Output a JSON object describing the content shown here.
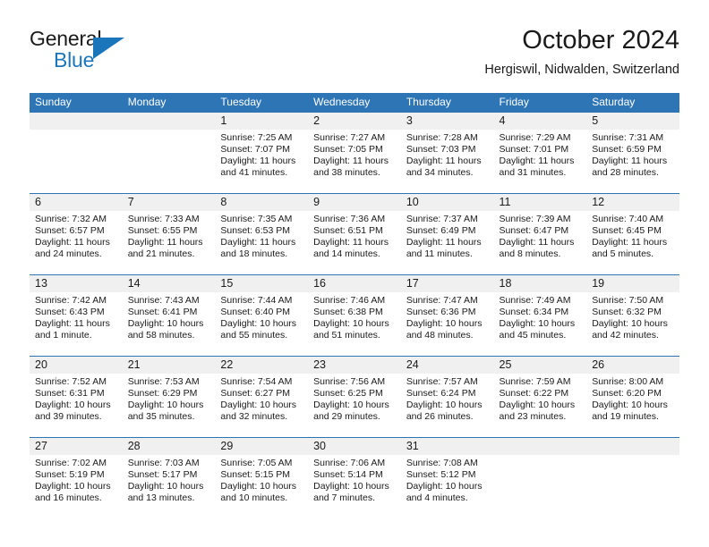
{
  "logo": {
    "word_one": "General",
    "word_two": "Blue",
    "flag_icon": "triangle-flag-icon",
    "accent_color": "#1b75bb"
  },
  "header": {
    "month_title": "October 2024",
    "location": "Hergiswil, Nidwalden, Switzerland"
  },
  "theme": {
    "header_bar_color": "#2e75b6",
    "daynum_band_color": "#f0f0f0",
    "text_color": "#1a1a1a"
  },
  "weekday_headers": [
    "Sunday",
    "Monday",
    "Tuesday",
    "Wednesday",
    "Thursday",
    "Friday",
    "Saturday"
  ],
  "weeks": [
    [
      {
        "day": "",
        "sunrise": "",
        "sunset": "",
        "daylight_line1": "",
        "daylight_line2": ""
      },
      {
        "day": "",
        "sunrise": "",
        "sunset": "",
        "daylight_line1": "",
        "daylight_line2": ""
      },
      {
        "day": "1",
        "sunrise": "Sunrise: 7:25 AM",
        "sunset": "Sunset: 7:07 PM",
        "daylight_line1": "Daylight: 11 hours",
        "daylight_line2": "and 41 minutes."
      },
      {
        "day": "2",
        "sunrise": "Sunrise: 7:27 AM",
        "sunset": "Sunset: 7:05 PM",
        "daylight_line1": "Daylight: 11 hours",
        "daylight_line2": "and 38 minutes."
      },
      {
        "day": "3",
        "sunrise": "Sunrise: 7:28 AM",
        "sunset": "Sunset: 7:03 PM",
        "daylight_line1": "Daylight: 11 hours",
        "daylight_line2": "and 34 minutes."
      },
      {
        "day": "4",
        "sunrise": "Sunrise: 7:29 AM",
        "sunset": "Sunset: 7:01 PM",
        "daylight_line1": "Daylight: 11 hours",
        "daylight_line2": "and 31 minutes."
      },
      {
        "day": "5",
        "sunrise": "Sunrise: 7:31 AM",
        "sunset": "Sunset: 6:59 PM",
        "daylight_line1": "Daylight: 11 hours",
        "daylight_line2": "and 28 minutes."
      }
    ],
    [
      {
        "day": "6",
        "sunrise": "Sunrise: 7:32 AM",
        "sunset": "Sunset: 6:57 PM",
        "daylight_line1": "Daylight: 11 hours",
        "daylight_line2": "and 24 minutes."
      },
      {
        "day": "7",
        "sunrise": "Sunrise: 7:33 AM",
        "sunset": "Sunset: 6:55 PM",
        "daylight_line1": "Daylight: 11 hours",
        "daylight_line2": "and 21 minutes."
      },
      {
        "day": "8",
        "sunrise": "Sunrise: 7:35 AM",
        "sunset": "Sunset: 6:53 PM",
        "daylight_line1": "Daylight: 11 hours",
        "daylight_line2": "and 18 minutes."
      },
      {
        "day": "9",
        "sunrise": "Sunrise: 7:36 AM",
        "sunset": "Sunset: 6:51 PM",
        "daylight_line1": "Daylight: 11 hours",
        "daylight_line2": "and 14 minutes."
      },
      {
        "day": "10",
        "sunrise": "Sunrise: 7:37 AM",
        "sunset": "Sunset: 6:49 PM",
        "daylight_line1": "Daylight: 11 hours",
        "daylight_line2": "and 11 minutes."
      },
      {
        "day": "11",
        "sunrise": "Sunrise: 7:39 AM",
        "sunset": "Sunset: 6:47 PM",
        "daylight_line1": "Daylight: 11 hours",
        "daylight_line2": "and 8 minutes."
      },
      {
        "day": "12",
        "sunrise": "Sunrise: 7:40 AM",
        "sunset": "Sunset: 6:45 PM",
        "daylight_line1": "Daylight: 11 hours",
        "daylight_line2": "and 5 minutes."
      }
    ],
    [
      {
        "day": "13",
        "sunrise": "Sunrise: 7:42 AM",
        "sunset": "Sunset: 6:43 PM",
        "daylight_line1": "Daylight: 11 hours",
        "daylight_line2": "and 1 minute."
      },
      {
        "day": "14",
        "sunrise": "Sunrise: 7:43 AM",
        "sunset": "Sunset: 6:41 PM",
        "daylight_line1": "Daylight: 10 hours",
        "daylight_line2": "and 58 minutes."
      },
      {
        "day": "15",
        "sunrise": "Sunrise: 7:44 AM",
        "sunset": "Sunset: 6:40 PM",
        "daylight_line1": "Daylight: 10 hours",
        "daylight_line2": "and 55 minutes."
      },
      {
        "day": "16",
        "sunrise": "Sunrise: 7:46 AM",
        "sunset": "Sunset: 6:38 PM",
        "daylight_line1": "Daylight: 10 hours",
        "daylight_line2": "and 51 minutes."
      },
      {
        "day": "17",
        "sunrise": "Sunrise: 7:47 AM",
        "sunset": "Sunset: 6:36 PM",
        "daylight_line1": "Daylight: 10 hours",
        "daylight_line2": "and 48 minutes."
      },
      {
        "day": "18",
        "sunrise": "Sunrise: 7:49 AM",
        "sunset": "Sunset: 6:34 PM",
        "daylight_line1": "Daylight: 10 hours",
        "daylight_line2": "and 45 minutes."
      },
      {
        "day": "19",
        "sunrise": "Sunrise: 7:50 AM",
        "sunset": "Sunset: 6:32 PM",
        "daylight_line1": "Daylight: 10 hours",
        "daylight_line2": "and 42 minutes."
      }
    ],
    [
      {
        "day": "20",
        "sunrise": "Sunrise: 7:52 AM",
        "sunset": "Sunset: 6:31 PM",
        "daylight_line1": "Daylight: 10 hours",
        "daylight_line2": "and 39 minutes."
      },
      {
        "day": "21",
        "sunrise": "Sunrise: 7:53 AM",
        "sunset": "Sunset: 6:29 PM",
        "daylight_line1": "Daylight: 10 hours",
        "daylight_line2": "and 35 minutes."
      },
      {
        "day": "22",
        "sunrise": "Sunrise: 7:54 AM",
        "sunset": "Sunset: 6:27 PM",
        "daylight_line1": "Daylight: 10 hours",
        "daylight_line2": "and 32 minutes."
      },
      {
        "day": "23",
        "sunrise": "Sunrise: 7:56 AM",
        "sunset": "Sunset: 6:25 PM",
        "daylight_line1": "Daylight: 10 hours",
        "daylight_line2": "and 29 minutes."
      },
      {
        "day": "24",
        "sunrise": "Sunrise: 7:57 AM",
        "sunset": "Sunset: 6:24 PM",
        "daylight_line1": "Daylight: 10 hours",
        "daylight_line2": "and 26 minutes."
      },
      {
        "day": "25",
        "sunrise": "Sunrise: 7:59 AM",
        "sunset": "Sunset: 6:22 PM",
        "daylight_line1": "Daylight: 10 hours",
        "daylight_line2": "and 23 minutes."
      },
      {
        "day": "26",
        "sunrise": "Sunrise: 8:00 AM",
        "sunset": "Sunset: 6:20 PM",
        "daylight_line1": "Daylight: 10 hours",
        "daylight_line2": "and 19 minutes."
      }
    ],
    [
      {
        "day": "27",
        "sunrise": "Sunrise: 7:02 AM",
        "sunset": "Sunset: 5:19 PM",
        "daylight_line1": "Daylight: 10 hours",
        "daylight_line2": "and 16 minutes."
      },
      {
        "day": "28",
        "sunrise": "Sunrise: 7:03 AM",
        "sunset": "Sunset: 5:17 PM",
        "daylight_line1": "Daylight: 10 hours",
        "daylight_line2": "and 13 minutes."
      },
      {
        "day": "29",
        "sunrise": "Sunrise: 7:05 AM",
        "sunset": "Sunset: 5:15 PM",
        "daylight_line1": "Daylight: 10 hours",
        "daylight_line2": "and 10 minutes."
      },
      {
        "day": "30",
        "sunrise": "Sunrise: 7:06 AM",
        "sunset": "Sunset: 5:14 PM",
        "daylight_line1": "Daylight: 10 hours",
        "daylight_line2": "and 7 minutes."
      },
      {
        "day": "31",
        "sunrise": "Sunrise: 7:08 AM",
        "sunset": "Sunset: 5:12 PM",
        "daylight_line1": "Daylight: 10 hours",
        "daylight_line2": "and 4 minutes."
      },
      {
        "day": "",
        "sunrise": "",
        "sunset": "",
        "daylight_line1": "",
        "daylight_line2": ""
      },
      {
        "day": "",
        "sunrise": "",
        "sunset": "",
        "daylight_line1": "",
        "daylight_line2": ""
      }
    ]
  ]
}
